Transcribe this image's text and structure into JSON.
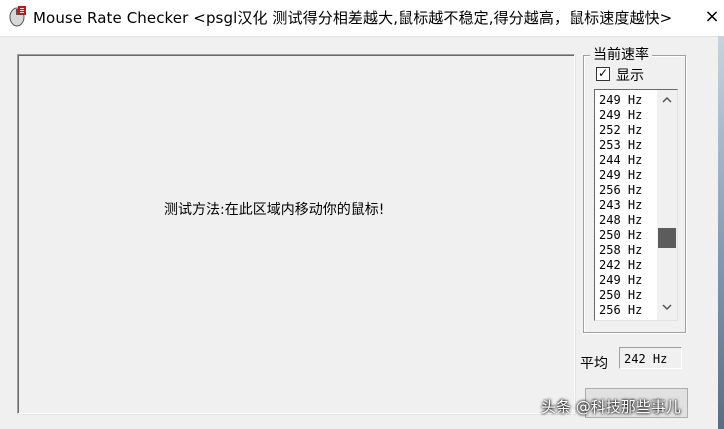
{
  "window": {
    "title": "Mouse Rate Checker <psgl汉化  测试得分相差越大,鼠标越不稳定,得分越高，鼠标速度越快>",
    "close_glyph": "×"
  },
  "test_area": {
    "instruction": "测试方法:在此区域内移动你的鼠标!"
  },
  "rate_panel": {
    "group_title": "当前速率",
    "show_label": "显示",
    "show_checked": true,
    "rates": [
      "249 Hz",
      "249 Hz",
      "252 Hz",
      "253 Hz",
      "244 Hz",
      "249 Hz",
      "256 Hz",
      "243 Hz",
      "248 Hz",
      "250 Hz",
      "258 Hz",
      "242 Hz",
      "249 Hz",
      "250 Hz",
      "256 Hz"
    ],
    "scroll_up_icon": "chevron-up-icon",
    "scroll_down_icon": "chevron-down-icon"
  },
  "average": {
    "label": "平均",
    "value": "242 Hz"
  },
  "watermark": {
    "text": "头条 @科技那些事儿"
  }
}
